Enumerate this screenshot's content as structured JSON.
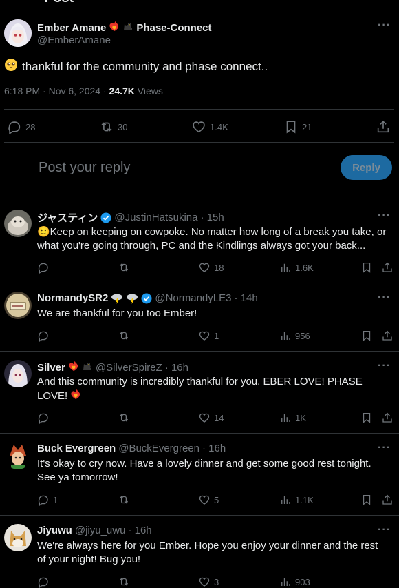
{
  "header": {
    "title": "Post"
  },
  "post": {
    "display_name": "Ember Amane",
    "name_suffix": "Phase-Connect",
    "handle": "@EmberAmane",
    "text": "thankful for the community and phase connect..",
    "timestamp": "6:18 PM · Nov 6, 2024 ·",
    "views_count": "24.7K",
    "views_label": "Views",
    "stats": {
      "replies": "28",
      "reposts": "30",
      "likes": "1.4K",
      "bookmarks": "21"
    }
  },
  "composer": {
    "placeholder": "Post your reply",
    "button_label": "Reply"
  },
  "replies": [
    {
      "name": "ジャスティン",
      "handle": "@JustinHatsukina",
      "time": "· 15h",
      "text": "🙂Keep on keeping on cowpoke.  No matter how long of a break you take, or what you're going through, PC and the Kindlings always got your back...",
      "replies": "",
      "likes": "18",
      "views": "1.6K"
    },
    {
      "name": "NormandySR2",
      "handle": "@NormandyLE3",
      "time": "· 14h",
      "text": "We are thankful for you too Ember!",
      "replies": "",
      "likes": "1",
      "views": "956"
    },
    {
      "name": "Silver",
      "handle": "@SilverSpireZ",
      "time": "· 16h",
      "text": "And this community is incredibly thankful for you. EBER LOVE! PHASE LOVE!",
      "replies": "",
      "likes": "14",
      "views": "1K"
    },
    {
      "name": "Buck Evergreen",
      "handle": "@BuckEvergreen",
      "time": "· 16h",
      "text": "It's okay to cry now. Have a lovely dinner and get some good rest tonight. See ya tomorrow!",
      "replies": "1",
      "likes": "5",
      "views": "1.1K"
    },
    {
      "name": "Jiyuwu",
      "handle": "@jiyu_uwu",
      "time": "· 16h",
      "text": "We're always here for you Ember. Hope you enjoy your dinner and the rest of your night! Bug you!",
      "replies": "",
      "likes": "3",
      "views": "903"
    }
  ],
  "more_icon": "more-horizontal-icon",
  "colors": {
    "accent": "#1d9bf0",
    "muted": "#71767b",
    "divider": "#2f3336",
    "reply_button": "#1d6aa1"
  }
}
